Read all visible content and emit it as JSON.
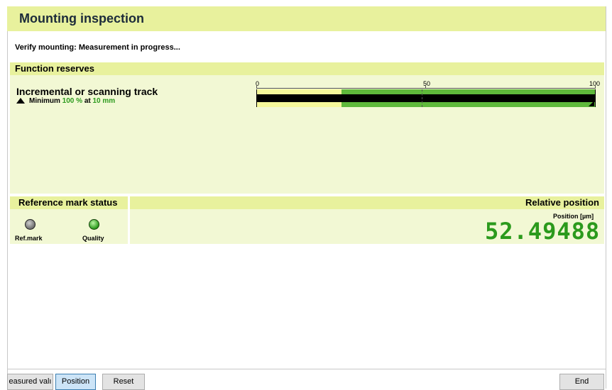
{
  "title": "Mounting inspection",
  "status": "Verify mounting: Measurement in progress...",
  "function_reserves": {
    "header": "Function reserves",
    "track_title": "Incremental or scanning track",
    "minimum_prefix": "Minimum",
    "minimum_value": "100 %",
    "minimum_at": "at",
    "minimum_distance": "10 mm",
    "scale": {
      "min": "0",
      "mid": "50",
      "max": "100"
    },
    "bar": {
      "yellow_percent": 25,
      "green_percent": 100,
      "black_percent": 100
    }
  },
  "reference_mark": {
    "header": "Reference mark status",
    "ref_label": "Ref.mark",
    "quality_label": "Quality",
    "ref_state": "gray",
    "quality_state": "green"
  },
  "relative_position": {
    "header": "Relative position",
    "unit_label": "Position [µm]",
    "value": "52.49488"
  },
  "buttons": {
    "measured_values": "easured valı",
    "position": "Position",
    "reset": "Reset",
    "end": "End"
  },
  "colors": {
    "header_bg": "#e8f19d",
    "panel_bg": "#f2f8d4",
    "green": "#2b9a1c"
  }
}
